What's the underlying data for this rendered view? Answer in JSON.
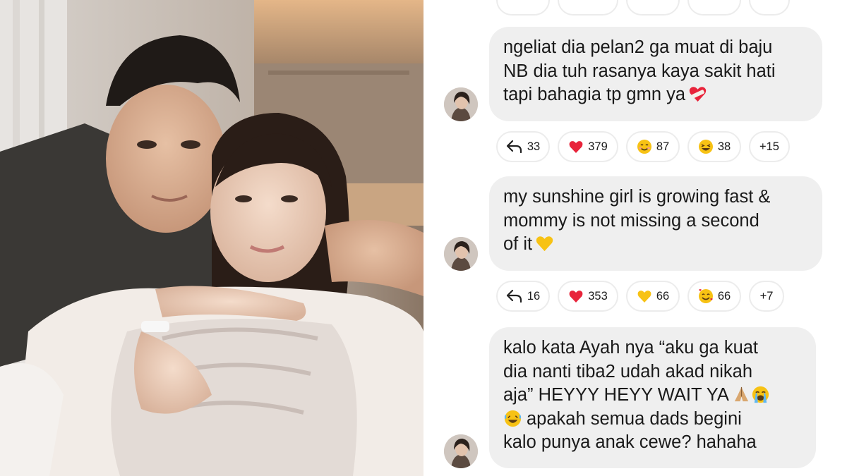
{
  "comments": [
    {
      "lines": [
        "ngeliat dia pelan2 ga muat di baju",
        "NB dia tuh rasanya kaya sakit hati",
        "tapi bahagia tp gmn ya"
      ],
      "reactions": [
        {
          "icon": "reply-icon",
          "count": "33"
        },
        {
          "icon": "heart-icon",
          "count": "379"
        },
        {
          "icon": "smiling-face-icon",
          "count": "87"
        },
        {
          "icon": "laughing-face-icon",
          "count": "38"
        },
        {
          "icon": "",
          "count": "+15"
        }
      ]
    },
    {
      "lines": [
        "my sunshine girl is growing fast &",
        "mommy is not missing a second",
        "of it"
      ],
      "reactions": [
        {
          "icon": "reply-icon",
          "count": "16"
        },
        {
          "icon": "heart-icon",
          "count": "353"
        },
        {
          "icon": "yellow-heart-icon",
          "count": "66"
        },
        {
          "icon": "smiling-face-with-hearts-icon",
          "count": "66"
        },
        {
          "icon": "",
          "count": "+7"
        }
      ]
    },
    {
      "lines": [
        "kalo kata Ayah nya “aku ga kuat",
        "dia nanti tiba2 udah akad nikah",
        "aja” HEYYY HEYY WAIT YA",
        "apakah semua dads begini",
        "kalo punya anak cewe? hahaha"
      ]
    }
  ],
  "colors": {
    "bubble": "#efefef",
    "heart": "#e8243b",
    "yellow": "#f7c214"
  }
}
